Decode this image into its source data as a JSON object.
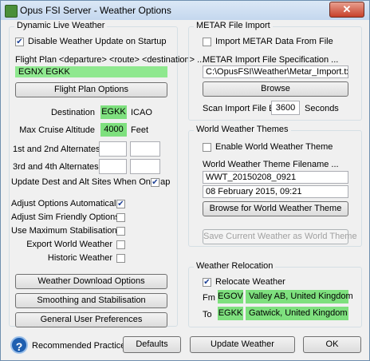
{
  "window": {
    "title": "Opus FSI Server - Weather Options",
    "close_glyph": "✕"
  },
  "dynamic": {
    "title": "Dynamic Live Weather",
    "disable_update_label": "Disable Weather Update on Startup",
    "disable_update_checked": true,
    "flight_plan_caption": "Flight Plan <departure> <route> <destination> ...",
    "flight_plan_value": "EGNX EGKK",
    "flight_plan_options_button": "Flight Plan Options",
    "destination_label": "Destination",
    "destination_value": "EGKK",
    "destination_unit": "ICAO",
    "max_cruise_label": "Max Cruise Altitude",
    "max_cruise_value": "4000",
    "max_cruise_unit": "Feet",
    "alt12_label": "1st and 2nd Alternates",
    "alt12_values": [
      "",
      ""
    ],
    "alt34_label": "3rd and 4th Alternates",
    "alt34_values": [
      "",
      ""
    ],
    "update_sites_label": "Update Dest and Alt Sites When On Map",
    "update_sites_checked": true,
    "options": [
      {
        "label": "Adjust Options Automatically",
        "checked": true
      },
      {
        "label": "Adjust Sim Friendly Options",
        "checked": false
      },
      {
        "label": "Use Maximum Stabilisation",
        "checked": false
      },
      {
        "label": "Export World Weather",
        "checked": false
      },
      {
        "label": "Historic Weather",
        "checked": false
      }
    ],
    "weather_download_button": "Weather Download Options",
    "smoothing_button": "Smoothing and Stabilisation",
    "general_prefs_button": "General User Preferences"
  },
  "metar": {
    "title": "METAR File Import",
    "import_label": "Import METAR Data From File",
    "import_checked": false,
    "spec_caption": "METAR Import File Specification ...",
    "spec_value": "C:\\OpusFSI\\Weather\\Metar_Import.txt",
    "browse_button": "Browse",
    "scan_label": "Scan Import File Every",
    "scan_value": "3600",
    "scan_unit": "Seconds"
  },
  "themes": {
    "title": "World Weather Themes",
    "enable_label": "Enable World Weather Theme",
    "enable_checked": false,
    "filename_caption": "World Weather Theme Filename ...",
    "filename_value": "WWT_20150208_0921",
    "date_value": "08 February 2015, 09:21",
    "browse_button": "Browse for World Weather Theme",
    "save_button": "Save Current Weather as World Theme"
  },
  "relocation": {
    "title": "Weather Relocation",
    "relocate_label": "Relocate Weather",
    "relocate_checked": true,
    "from_label": "Fm",
    "from_icao": "EGOV",
    "from_name": "Valley AB, United Kingdom",
    "to_label": "To",
    "to_icao": "EGKK",
    "to_name": "Gatwick, United Kingdom"
  },
  "footer": {
    "help_glyph": "?",
    "recommended_label": "Recommended Practices",
    "defaults_button": "Defaults",
    "update_button": "Update Weather",
    "ok_button": "OK"
  },
  "colors": {
    "highlight_green": "#8fe88f",
    "checkmark": "#1c3f94",
    "help_blue": "#1f5fb0"
  }
}
